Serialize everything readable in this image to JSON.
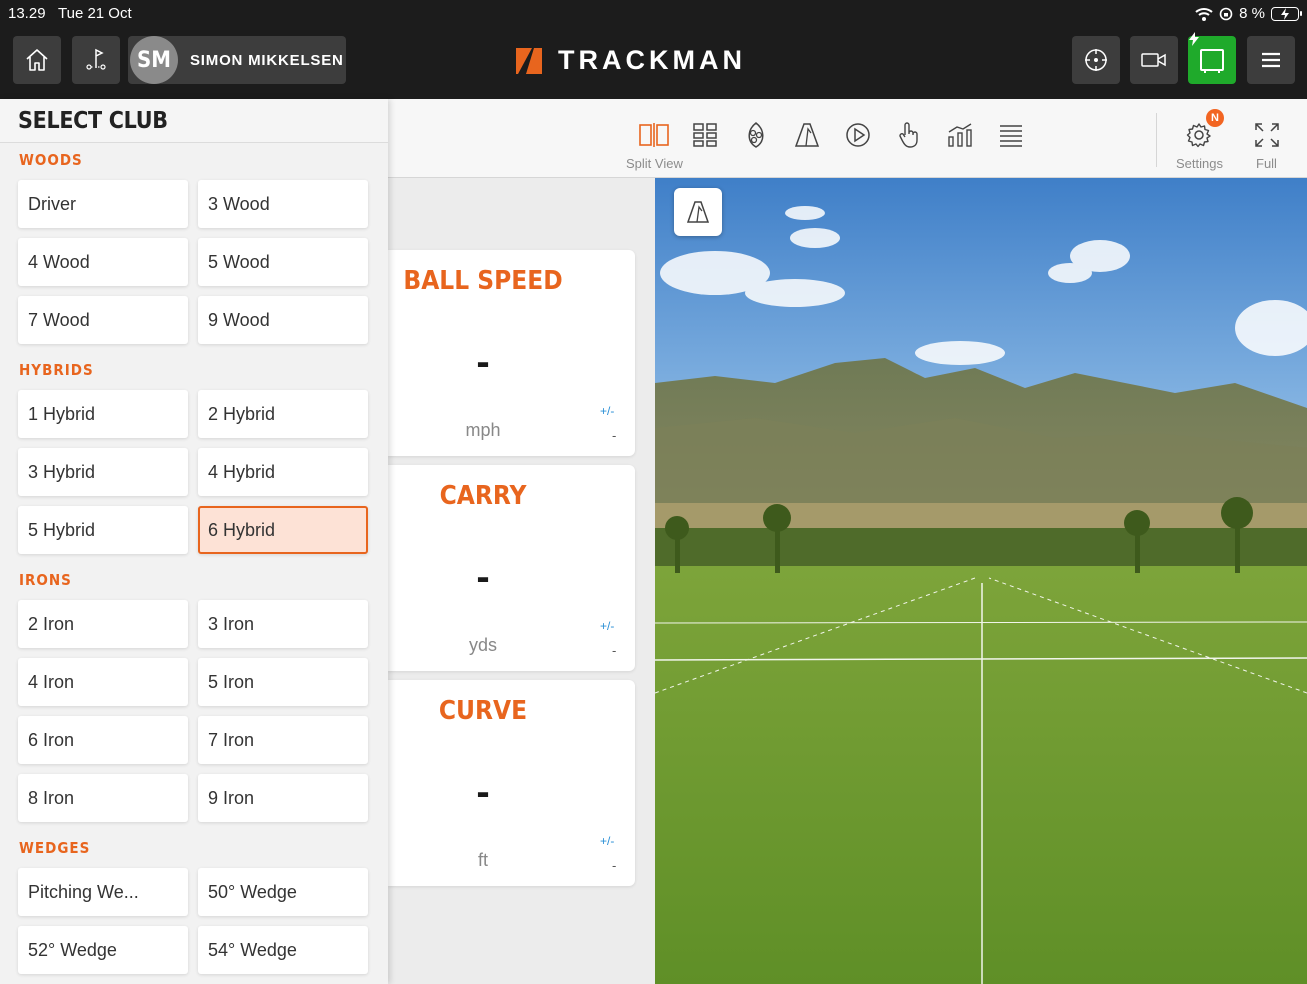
{
  "status_bar": {
    "time": "13.29",
    "date": "Tue 21 Oct",
    "battery": "8 %"
  },
  "header": {
    "user_initials": "SM",
    "user_name": "SIMON MIKKELSEN",
    "brand": "TRACKMAN",
    "brand_color": "#e8651e",
    "active_color": "#1faa2b"
  },
  "toolbar": {
    "split_view_label": "Split View",
    "settings_label": "Settings",
    "settings_badge": "N",
    "full_label": "Full"
  },
  "club_panel": {
    "title": "SELECT CLUB",
    "categories": [
      {
        "name": "WOODS",
        "clubs": [
          "Driver",
          "3 Wood",
          "4 Wood",
          "5 Wood",
          "7 Wood",
          "9 Wood"
        ]
      },
      {
        "name": "HYBRIDS",
        "clubs": [
          "1 Hybrid",
          "2 Hybrid",
          "3 Hybrid",
          "4 Hybrid",
          "5 Hybrid",
          "6 Hybrid"
        ]
      },
      {
        "name": "IRONS",
        "clubs": [
          "2 Iron",
          "3 Iron",
          "4 Iron",
          "5 Iron",
          "6 Iron",
          "7 Iron",
          "8 Iron",
          "9 Iron"
        ]
      },
      {
        "name": "WEDGES",
        "clubs": [
          "Pitching We...",
          "50° Wedge",
          "52° Wedge",
          "54° Wedge"
        ]
      }
    ],
    "selected_club": "6 Hybrid"
  },
  "metrics": [
    {
      "title": "BALL SPEED",
      "value": "-",
      "unit": "mph",
      "tolerance_label": "+/-",
      "tolerance_value": "-"
    },
    {
      "title": "CARRY",
      "value": "-",
      "unit": "yds",
      "tolerance_label": "+/-",
      "tolerance_value": "-"
    },
    {
      "title": "CURVE",
      "value": "-",
      "unit": "ft",
      "tolerance_label": "+/-",
      "tolerance_value": "-"
    }
  ]
}
